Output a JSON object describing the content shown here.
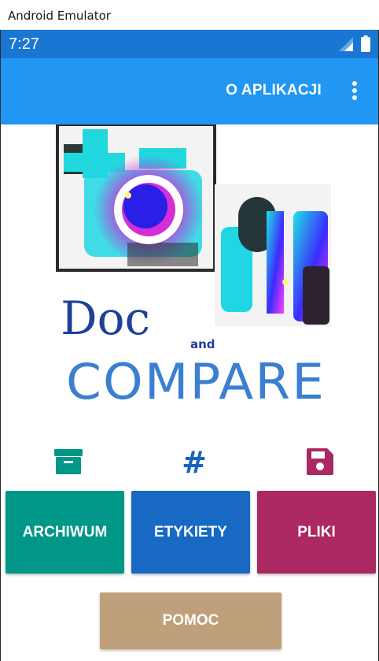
{
  "window": {
    "title": "Android Emulator"
  },
  "status_bar": {
    "time": "7:27",
    "background": "#1976d2"
  },
  "app_bar": {
    "about_label": "O APLIKACJI",
    "background": "#2196f3",
    "menu_icon": "more-vert-icon"
  },
  "logo": {
    "title_primary": "Doc",
    "title_connector": "and",
    "title_secondary": "COMPARE",
    "primary_color": "#1e3f9a",
    "secondary_color": "#3a7fd1"
  },
  "categories": [
    {
      "id": "archive",
      "label": "ARCHIWUM",
      "icon": "archive-box-icon",
      "color": "#009688"
    },
    {
      "id": "tags",
      "label": "ETYKIETY",
      "icon": "hashtag-icon",
      "color": "#1565c0"
    },
    {
      "id": "files",
      "label": "PLIKI",
      "icon": "floppy-disk-icon",
      "color": "#ab2862"
    }
  ],
  "help": {
    "label": "POMOC",
    "color": "#bfa07a"
  },
  "colors": {
    "archive": "#009688",
    "tags": "#1565c0",
    "files": "#ab2862",
    "tags_tile": "#1769c4",
    "help": "#bfa07a"
  }
}
